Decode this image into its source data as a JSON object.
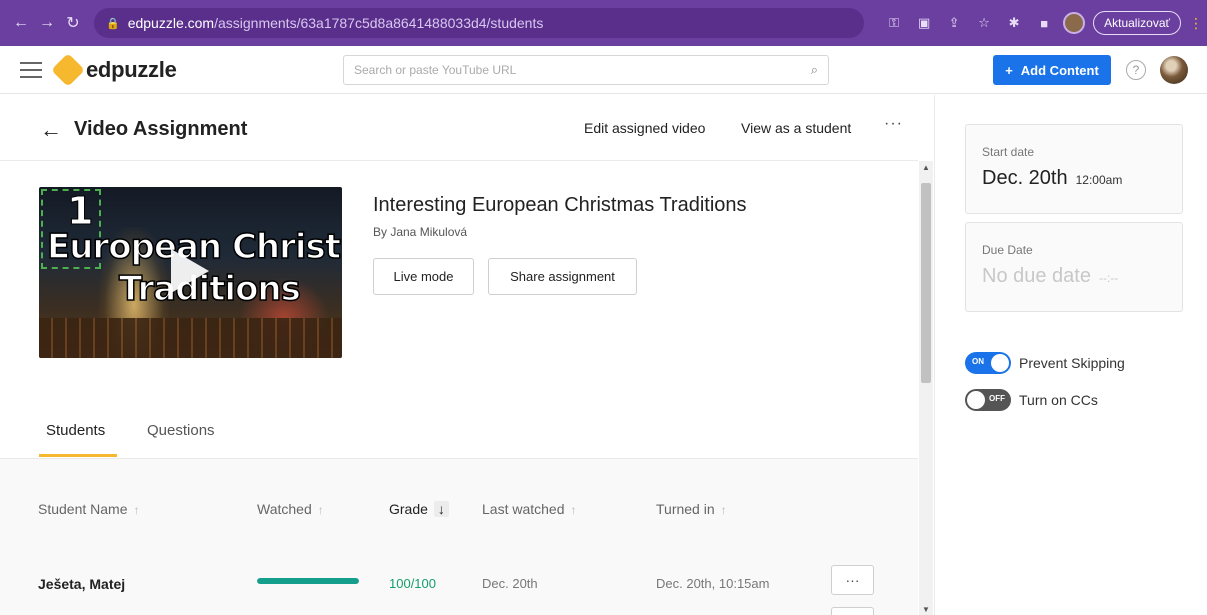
{
  "browser": {
    "url_host": "edpuzzle.com",
    "url_path": "/assignments/63a1787c5d8a8641488033d4/students",
    "update_label": "Aktualizovať"
  },
  "header": {
    "logo_text": "edpuzzle",
    "search_placeholder": "Search or paste YouTube URL",
    "add_content_label": "Add Content",
    "add_content_plus": "+",
    "help_glyph": "?"
  },
  "topbar": {
    "title": "Video Assignment",
    "back_glyph": "←",
    "edit_label": "Edit assigned video",
    "view_label": "View as a student",
    "more_glyph": "···"
  },
  "video": {
    "thumb_number": "1",
    "thumb_line1": "European Christmas",
    "thumb_line2": "Traditions",
    "title": "Interesting European Christmas Traditions",
    "author": "By Jana Mikulová",
    "live_mode_label": "Live mode",
    "share_label": "Share assignment"
  },
  "tabs": [
    {
      "label": "Students"
    },
    {
      "label": "Questions"
    }
  ],
  "table": {
    "columns": [
      {
        "label": "Student Name",
        "sort": "↑"
      },
      {
        "label": "Watched",
        "sort": "↑"
      },
      {
        "label": "Grade",
        "sort": "↓"
      },
      {
        "label": "Last watched",
        "sort": "↑"
      },
      {
        "label": "Turned in",
        "sort": "↑"
      }
    ],
    "rows": [
      {
        "name": "Ješeta, Matej",
        "watched_fraction": 1.0,
        "grade": "100/100",
        "last_watched": "Dec. 20th",
        "turned_in": "Dec. 20th, 10:15am",
        "more": "···"
      }
    ]
  },
  "side": {
    "start_label": "Start date",
    "start_date": "Dec. 20th",
    "start_time": "12:00am",
    "due_label": "Due Date",
    "due_date": "No due date",
    "due_time": "--:--",
    "prevent_skipping_label": "Prevent Skipping",
    "prevent_skipping_state": "ON",
    "ccs_label": "Turn on CCs",
    "ccs_state": "OFF"
  },
  "colors": {
    "chrome": "#6b3fa0",
    "accent_blue": "#1a73e8",
    "tab_underline": "#f5b82e",
    "grade_green": "#149e6c",
    "progress_teal": "#149e8c"
  }
}
